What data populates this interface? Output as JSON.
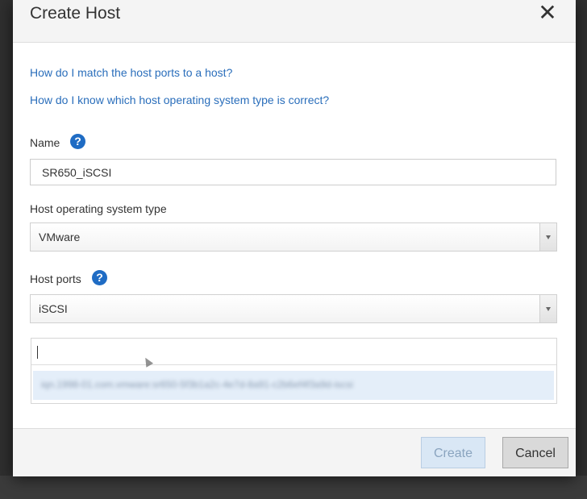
{
  "dialog": {
    "title": "Create Host",
    "close_icon": "close-icon"
  },
  "help_links": [
    "How do I match the host ports to a host?",
    "How do I know which host operating system type is correct?"
  ],
  "name_field": {
    "label": "Name",
    "value": "SR650_iSCSI",
    "help_icon": "question-circle-icon"
  },
  "os_field": {
    "label": "Host operating system type",
    "selected": "VMware"
  },
  "ports_field": {
    "label": "Host ports",
    "help_icon": "question-circle-icon",
    "selected": "iSCSI",
    "input_value": "",
    "suggestion": "iqn.1998-01.com.vmware:sr650-5f3b1a2c-4e7d-8a91-c2b6ef4f3a9d-iscsi"
  },
  "footer": {
    "create_label": "Create",
    "cancel_label": "Cancel"
  },
  "colors": {
    "link": "#2a6ebb",
    "help_icon": "#1f6cc4",
    "suggestion_bg": "#e4eef9",
    "create_disabled_bg": "#d9e7f5"
  }
}
